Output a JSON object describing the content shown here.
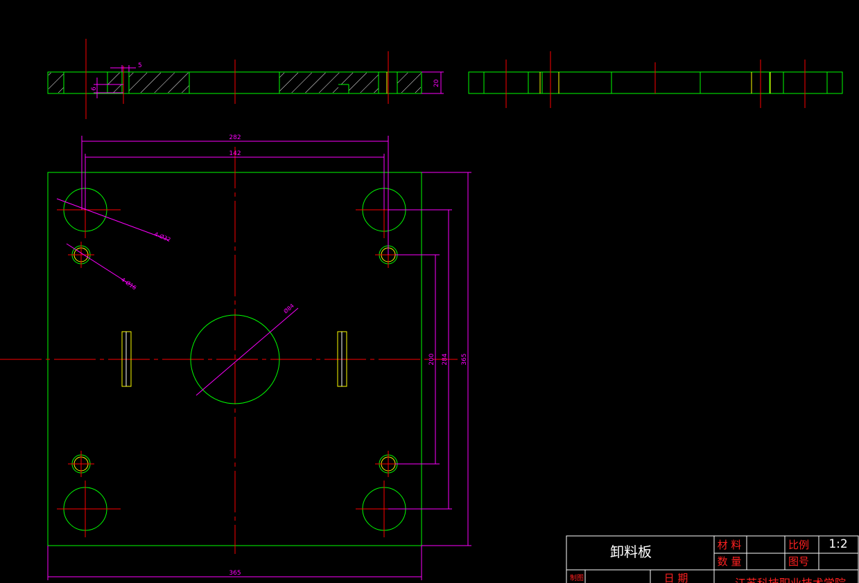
{
  "drawing": {
    "dimensions": {
      "small_5": "5",
      "small_6": "6",
      "thickness": "20",
      "width_outer": "282",
      "width_inner": "142",
      "height_200": "200",
      "height_284": "284",
      "height_total": "365",
      "bottom_width": "365",
      "holes_large": "4-Ø32",
      "holes_small": "4-Ø16",
      "center_hole": "Ø84"
    },
    "title_block": {
      "part_name": "卸料板",
      "material_label": "材 料",
      "quantity_label": "数 量",
      "scale_label": "比例",
      "scale_value": "1:2",
      "drawing_no_label": "图号",
      "drafter_label": "制图",
      "date_label": "日  期",
      "org_text": "江苏科技职业技术学院"
    },
    "colors": {
      "outline": "#00ff00",
      "centerline": "#ff0000",
      "dimension": "#ff00ff",
      "highlight": "#ffff00",
      "title_line": "#ffffff",
      "title_red": "#ff2020"
    }
  }
}
